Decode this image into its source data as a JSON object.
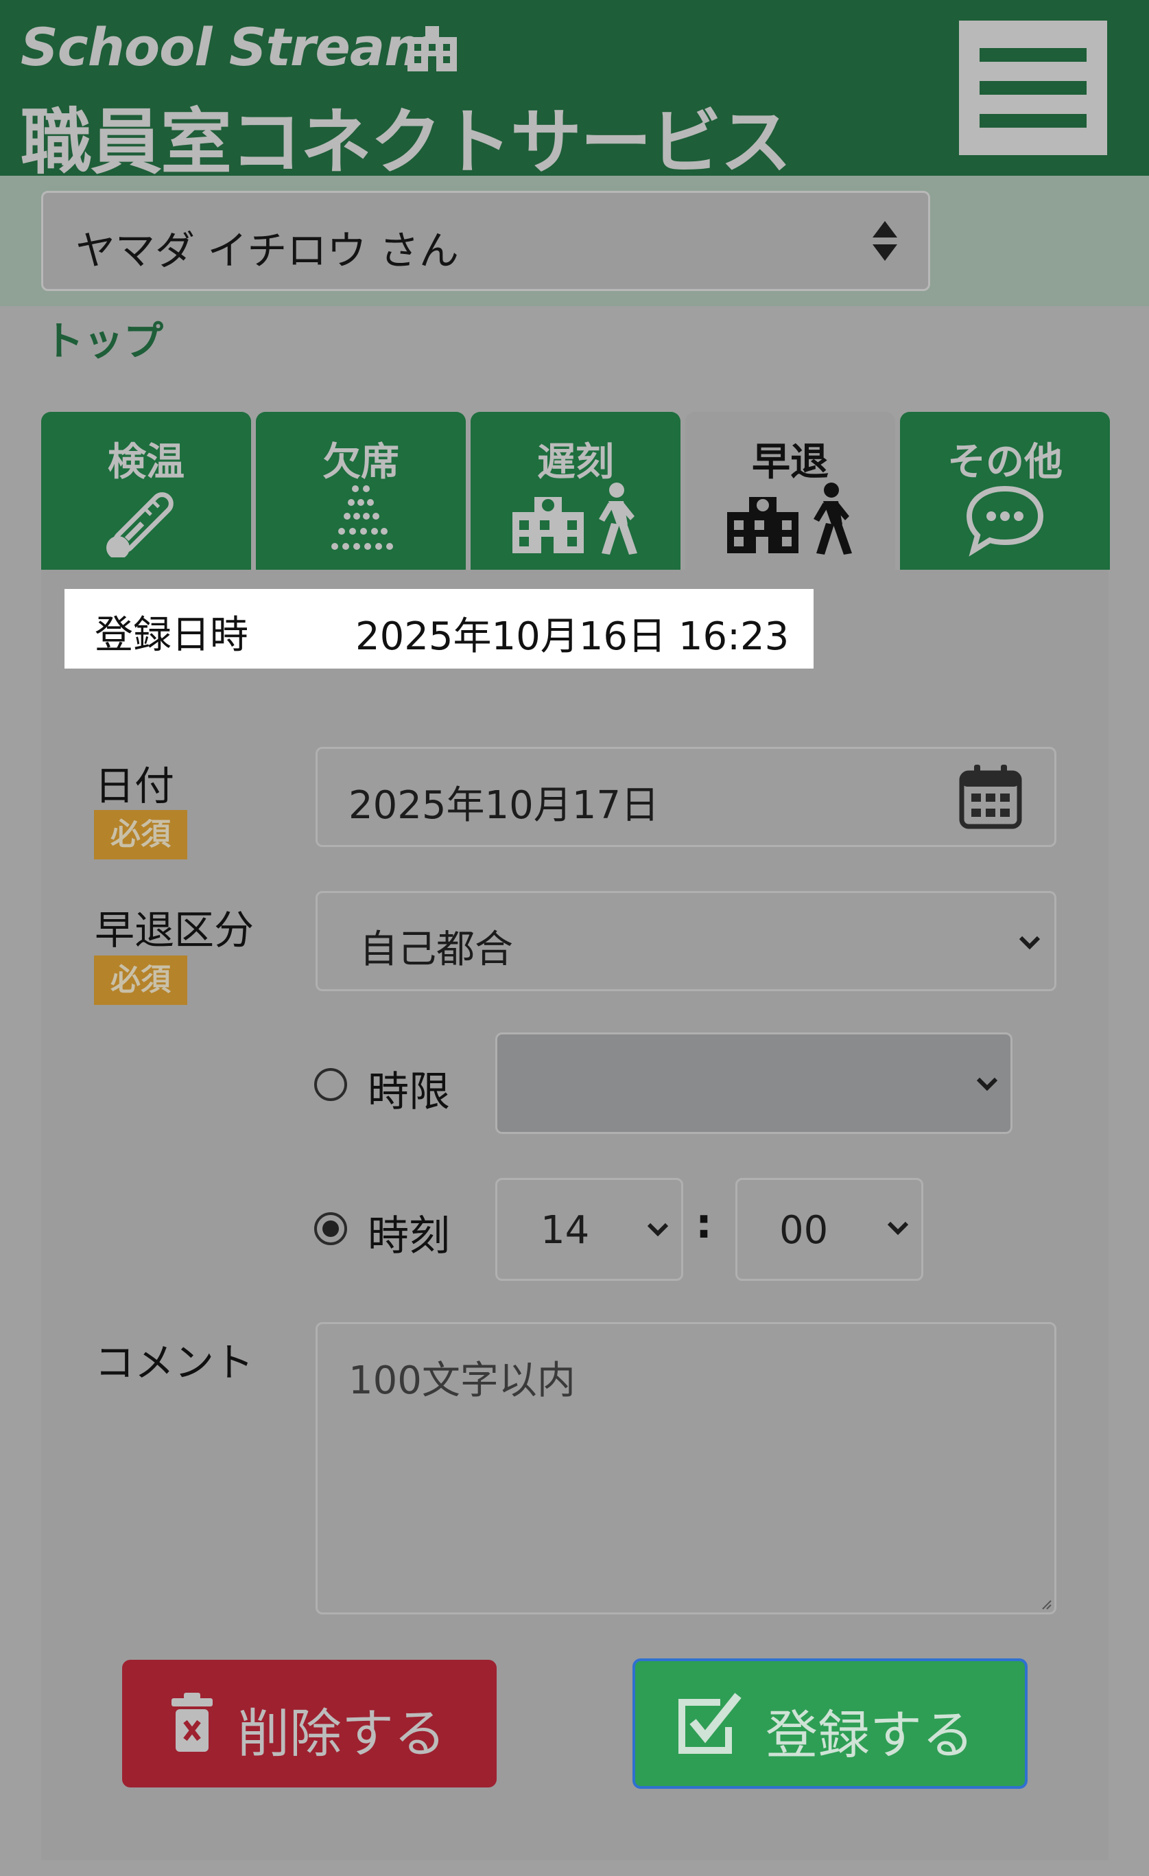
{
  "header": {
    "brand_line1": "School Stream",
    "brand_line2": "職員室コネクトサービス"
  },
  "student": {
    "name": "ヤマダ イチロウ さん"
  },
  "breadcrumb": {
    "top": "トップ"
  },
  "tabs": [
    {
      "label": "検温",
      "icon": "thermometer-icon",
      "active": false
    },
    {
      "label": "欠席",
      "icon": "dots-icon",
      "active": false
    },
    {
      "label": "遅刻",
      "icon": "school-walk-icon",
      "active": false
    },
    {
      "label": "早退",
      "icon": "school-walk-icon",
      "active": true
    },
    {
      "label": "その他",
      "icon": "chat-bubble-icon",
      "active": false
    }
  ],
  "registration": {
    "label": "登録日時",
    "value": "2025年10月16日 16:23"
  },
  "form": {
    "date_label": "日付",
    "required_label": "必須",
    "date_value": "2025年10月17日",
    "reason_label": "早退区分",
    "reason_value": "自己都合",
    "period_label": "時限",
    "period_value": "",
    "time_label": "時刻",
    "hour_value": "14",
    "minute_value": "00",
    "time_separator": ":",
    "comment_label": "コメント",
    "comment_placeholder": "100文字以内",
    "selected_mode": "time"
  },
  "buttons": {
    "delete_label": "削除する",
    "register_label": "登録する"
  },
  "colors": {
    "header_bg": "#1e5e38",
    "tab_bg": "#1e6e3e",
    "required_badge": "#b5832a",
    "delete_button": "#9e2130",
    "register_button": "#2e9e54"
  }
}
